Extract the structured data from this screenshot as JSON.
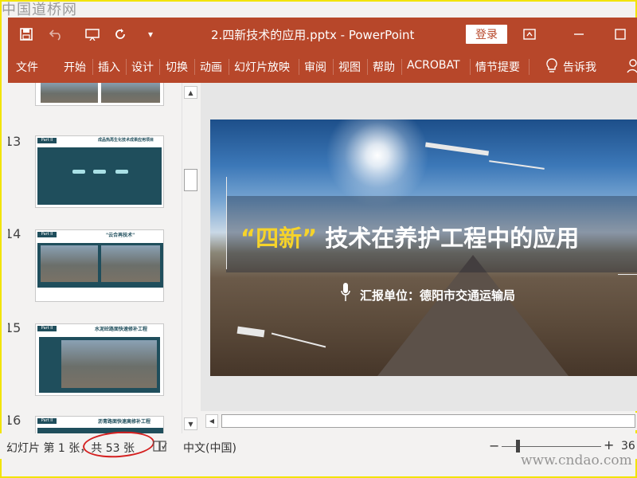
{
  "watermark": {
    "top": "中国道桥网",
    "bottom": "www.cndao.com"
  },
  "app": {
    "title": "2.四新技术的应用.pptx  -  PowerPoint",
    "login": "登录"
  },
  "ribbon": {
    "tabs": [
      "文件",
      "开始",
      "插入",
      "设计",
      "切换",
      "动画",
      "幻灯片放映",
      "审阅",
      "视图",
      "帮助",
      "ACROBAT",
      "情节提要"
    ],
    "tell_me": "告诉我"
  },
  "thumbnails": [
    {
      "num": "",
      "part": "",
      "title": ""
    },
    {
      "num": "13",
      "part": "Part II",
      "title": "成品热再生化技术成果应用项目"
    },
    {
      "num": "14",
      "part": "Part II",
      "title": "\"云合再技术\""
    },
    {
      "num": "15",
      "part": "Part II",
      "title": "水泥砼路面快速修补工程"
    },
    {
      "num": "16",
      "part": "Part II",
      "title": "沥青路面快速高修补工程"
    }
  ],
  "slide": {
    "title_quote_open": "“",
    "title_highlight": "四新",
    "title_quote_close": "”",
    "title_rest": " 技术在养护工程中的应用",
    "reporter": "汇报单位：德阳市交通运输局"
  },
  "status": {
    "slide_info": "幻灯片 第 1 张，共 53 张",
    "language": "中文(中国)",
    "zoom": "36"
  },
  "colors": {
    "accent": "#b7472a",
    "highlight": "#f6d32a",
    "annotation": "#d42020"
  }
}
